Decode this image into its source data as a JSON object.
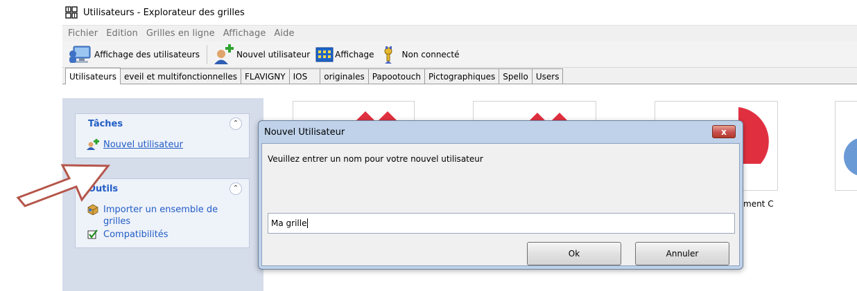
{
  "window": {
    "title": "Utilisateurs - Explorateur des grilles"
  },
  "menu": [
    "Fichier",
    "Edition",
    "Grilles en ligne",
    "Affichage",
    "Aide"
  ],
  "toolbar": {
    "show_users": "Affichage des utilisateurs",
    "new_user": "Nouvel utilisateur",
    "display": "Affichage",
    "status": "Non connecté"
  },
  "tabs": [
    "Utilisateurs",
    "eveil et multifonctionnelles",
    "FLAVIGNY",
    "IOS",
    "originales",
    "Papootouch",
    "Pictographiques",
    "Spello",
    "Users"
  ],
  "active_tab": 0,
  "tasks_panel": {
    "title": "Tâches",
    "items": [
      "Nouvel utilisateur"
    ]
  },
  "tools_panel": {
    "title": "Outils",
    "items": [
      "Importer un ensemble de grilles",
      "Compatibilités"
    ]
  },
  "grid": {
    "partial_label": "ment C"
  },
  "dialog": {
    "title": "Nouvel Utilisateur",
    "close": "x",
    "prompt": "Veuillez entrer un nom pour votre nouvel utilisateur",
    "input_value": "Ma grille",
    "ok": "Ok",
    "cancel": "Annuler"
  },
  "colors": {
    "accent_red": "#e03040",
    "link_blue": "#215dc6",
    "arrow": "#b5554a"
  }
}
